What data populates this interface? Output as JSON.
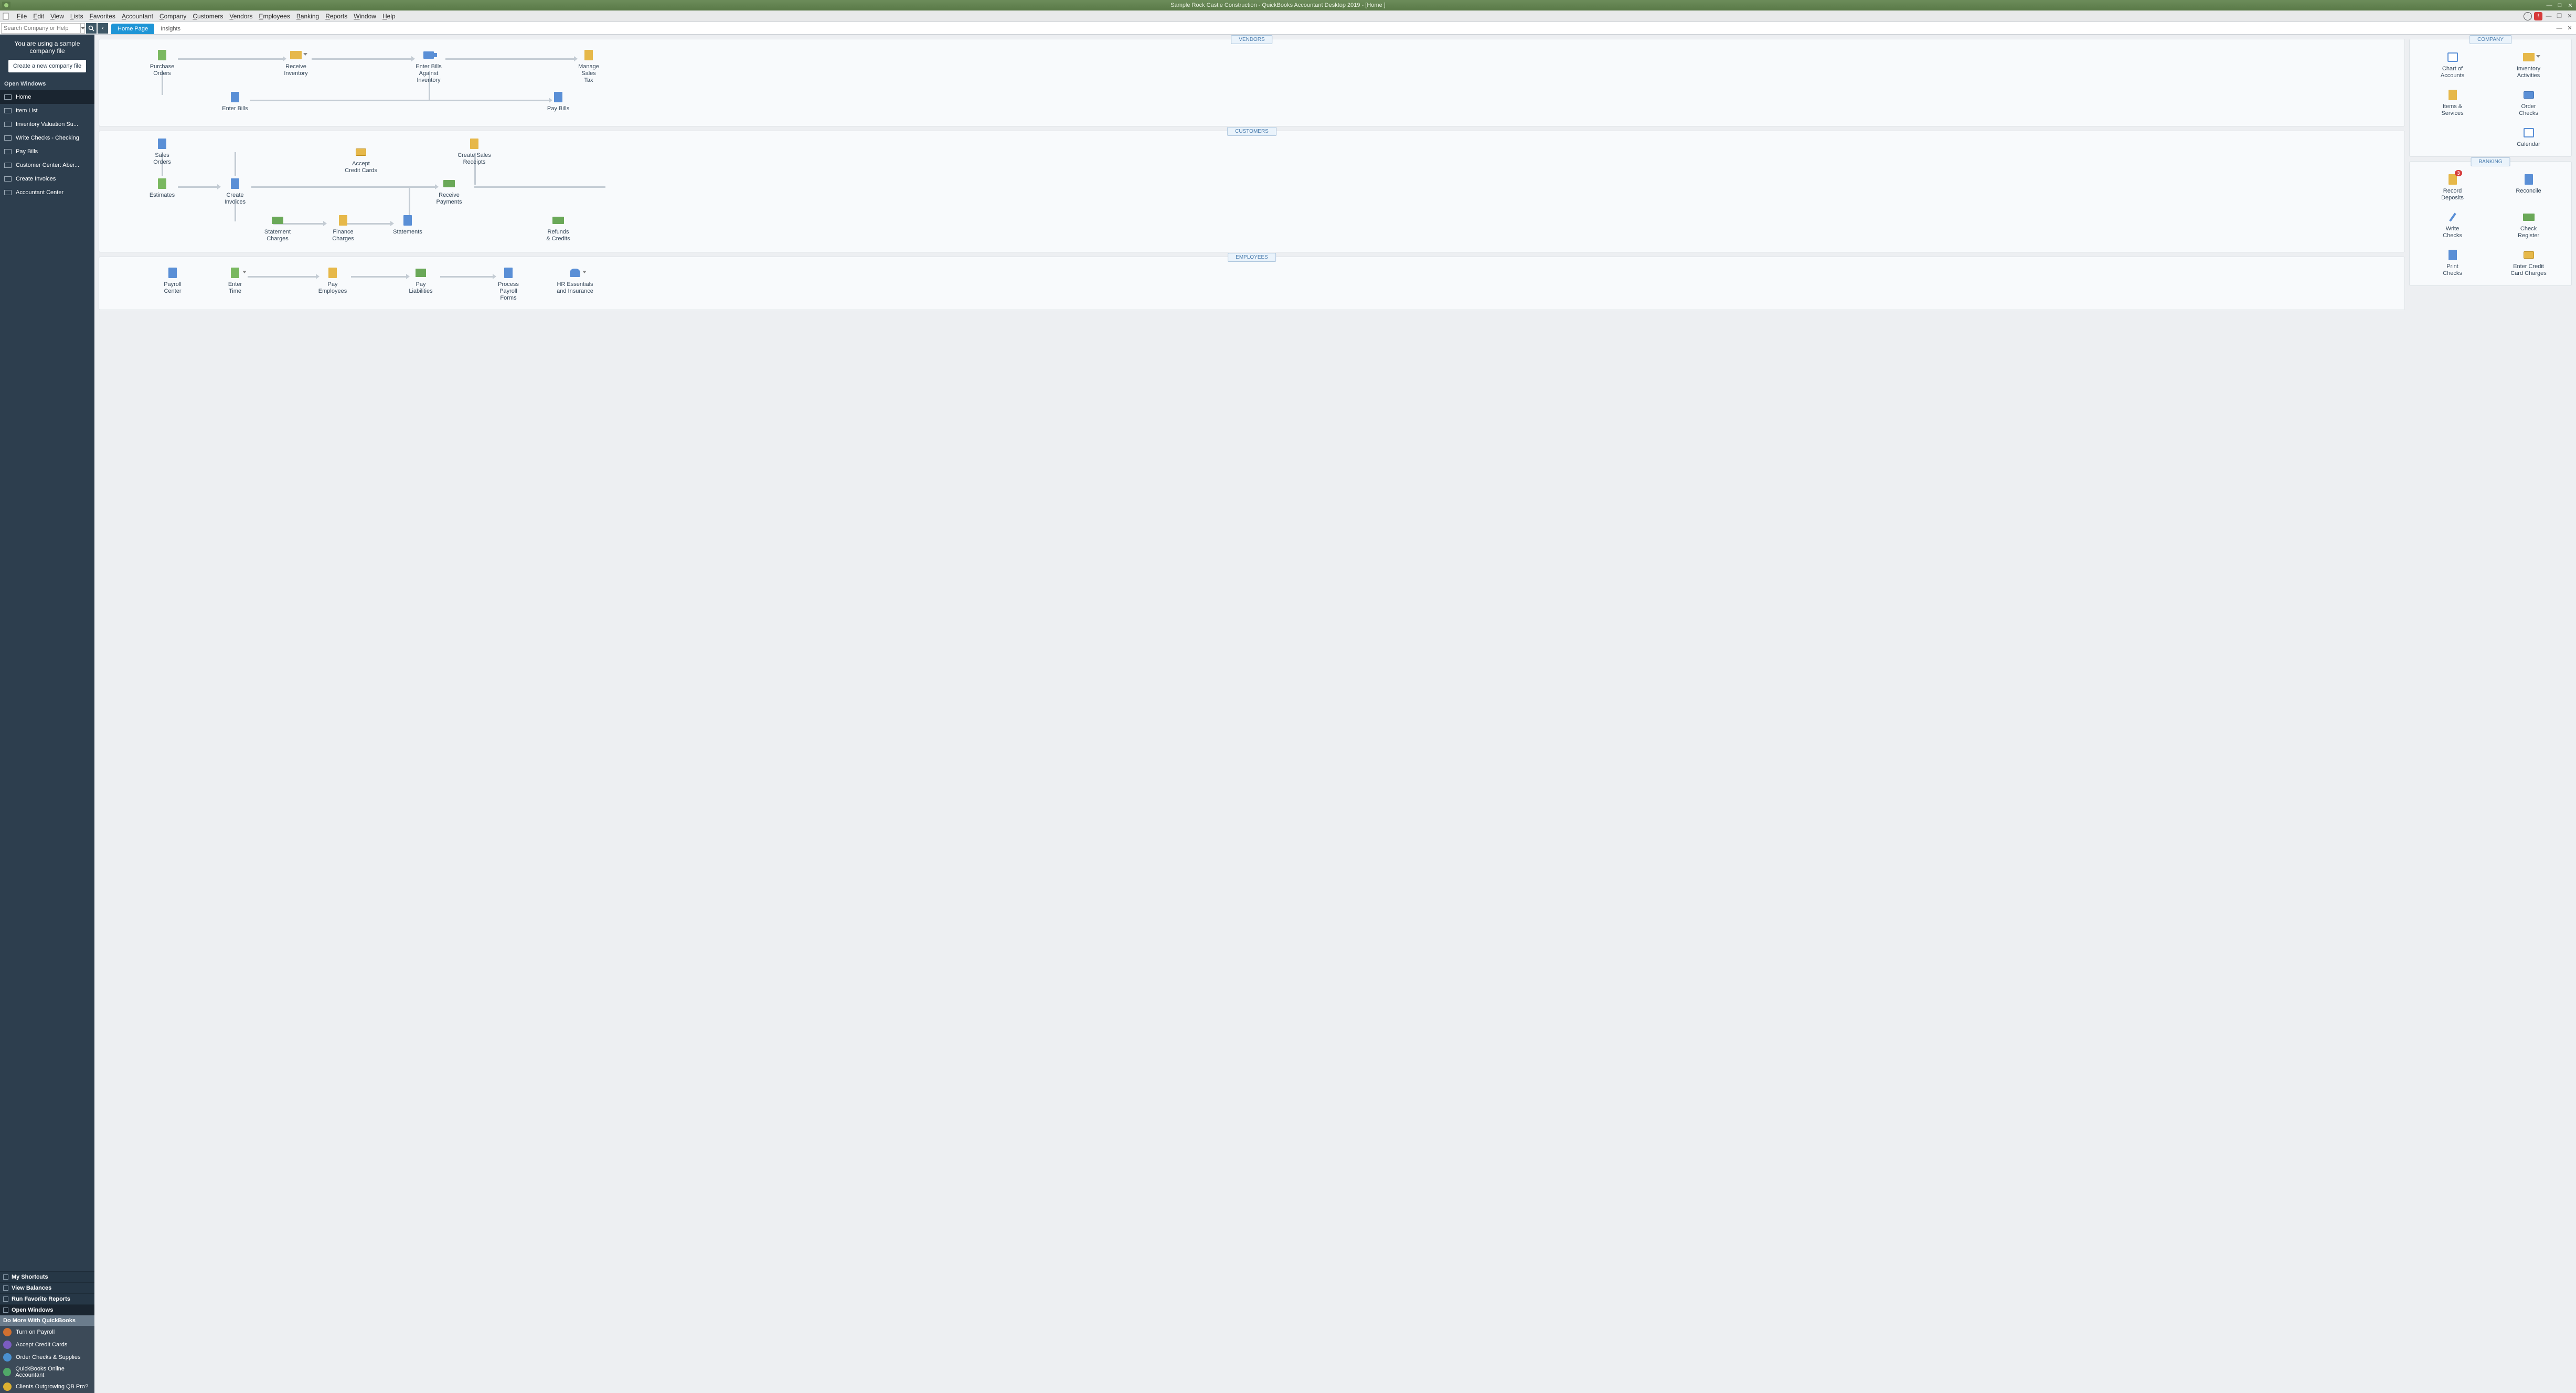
{
  "titlebar": {
    "title": "Sample Rock Castle Construction - QuickBooks Accountant Desktop 2019 - [Home ]"
  },
  "menubar": {
    "items": [
      "File",
      "Edit",
      "View",
      "Lists",
      "Favorites",
      "Accountant",
      "Company",
      "Customers",
      "Vendors",
      "Employees",
      "Banking",
      "Reports",
      "Window",
      "Help"
    ]
  },
  "search": {
    "placeholder": "Search Company or Help"
  },
  "tabs": {
    "home": "Home Page",
    "insights": "Insights"
  },
  "sidebar": {
    "notice_l1": "You are using a sample",
    "notice_l2": "company file",
    "create_btn": "Create a new company file",
    "open_windows_hdr": "Open Windows",
    "windows": [
      {
        "label": "Home"
      },
      {
        "label": "Item List"
      },
      {
        "label": "Inventory Valuation Su..."
      },
      {
        "label": "Write Checks - Checking"
      },
      {
        "label": "Pay Bills"
      },
      {
        "label": "Customer Center: Aber..."
      },
      {
        "label": "Create Invoices"
      },
      {
        "label": "Accountant Center"
      }
    ],
    "shortcuts": [
      {
        "label": "My Shortcuts"
      },
      {
        "label": "View Balances"
      },
      {
        "label": "Run Favorite Reports"
      },
      {
        "label": "Open Windows"
      }
    ],
    "domore_hdr": "Do More With QuickBooks",
    "domore": [
      {
        "label": "Turn on Payroll",
        "color": "#D07030"
      },
      {
        "label": "Accept Credit Cards",
        "color": "#7A5CC0"
      },
      {
        "label": "Order Checks & Supplies",
        "color": "#4A90D0"
      },
      {
        "label": "QuickBooks Online Accountant",
        "color": "#50A868"
      },
      {
        "label": "Clients Outgrowing QB Pro?",
        "color": "#DDB030"
      }
    ]
  },
  "vendors": {
    "title": "VENDORS",
    "purchase": "Purchase\nOrders",
    "receive_inv": "Receive\nInventory",
    "enter_against": "Enter Bills\nAgainst\nInventory",
    "manage_tax": "Manage\nSales\nTax",
    "enter_bills": "Enter Bills",
    "pay_bills": "Pay Bills"
  },
  "customers": {
    "title": "CUSTOMERS",
    "sales_orders": "Sales\nOrders",
    "accept_cc": "Accept\nCredit Cards",
    "create_receipts": "Create Sales\nReceipts",
    "estimates": "Estimates",
    "create_inv": "Create\nInvoices",
    "receive_pay": "Receive\nPayments",
    "stmt_charges": "Statement\nCharges",
    "finance_charges": "Finance\nCharges",
    "statements": "Statements",
    "refunds": "Refunds\n& Credits"
  },
  "employees": {
    "title": "EMPLOYEES",
    "payroll_center": "Payroll\nCenter",
    "enter_time": "Enter\nTime",
    "pay_emp": "Pay\nEmployees",
    "pay_liab": "Pay\nLiabilities",
    "process_forms": "Process\nPayroll\nForms",
    "hr": "HR Essentials\nand Insurance"
  },
  "company": {
    "title": "COMPANY",
    "chart": "Chart of\nAccounts",
    "inv_act": "Inventory\nActivities",
    "items": "Items &\nServices",
    "order_checks": "Order\nChecks",
    "calendar": "Calendar"
  },
  "banking": {
    "title": "BANKING",
    "record_dep": "Record\nDeposits",
    "badge": "3",
    "reconcile": "Reconcile",
    "write_checks": "Write\nChecks",
    "check_reg": "Check\nRegister",
    "print_checks": "Print\nChecks",
    "enter_cc": "Enter Credit\nCard Charges"
  }
}
